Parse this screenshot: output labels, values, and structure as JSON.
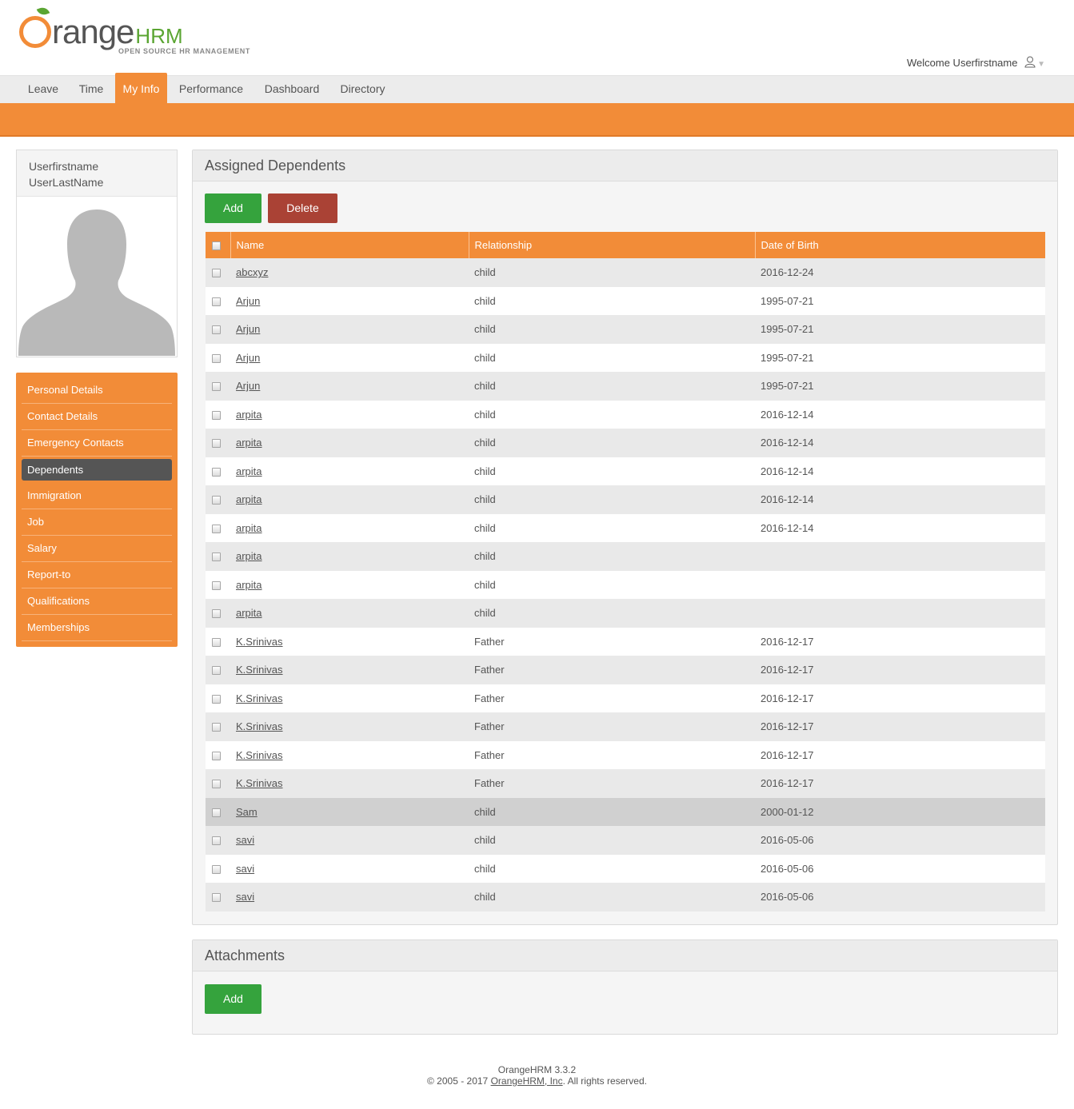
{
  "brand": {
    "name_main": "range",
    "name_hrm": "HRM",
    "tagline": "OPEN SOURCE HR MANAGEMENT",
    "accent_color": "#f28c38",
    "green_color": "#5aa532"
  },
  "header": {
    "welcome": "Welcome Userfirstname"
  },
  "nav": {
    "items": [
      "Leave",
      "Time",
      "My Info",
      "Performance",
      "Dashboard",
      "Directory"
    ],
    "active": "My Info"
  },
  "profile": {
    "first_name": "Userfirstname",
    "last_name": "UserLastName"
  },
  "side_menu": {
    "items": [
      "Personal Details",
      "Contact Details",
      "Emergency Contacts",
      "Dependents",
      "Immigration",
      "Job",
      "Salary",
      "Report-to",
      "Qualifications",
      "Memberships"
    ],
    "active": "Dependents"
  },
  "dependents": {
    "title": "Assigned Dependents",
    "add_label": "Add",
    "delete_label": "Delete",
    "columns": [
      "Name",
      "Relationship",
      "Date of Birth"
    ],
    "rows": [
      {
        "name": "abcxyz",
        "relationship": "child",
        "dob": "2016-12-24"
      },
      {
        "name": "Arjun",
        "relationship": "child",
        "dob": "1995-07-21"
      },
      {
        "name": "Arjun",
        "relationship": "child",
        "dob": "1995-07-21"
      },
      {
        "name": "Arjun",
        "relationship": "child",
        "dob": "1995-07-21"
      },
      {
        "name": "Arjun",
        "relationship": "child",
        "dob": "1995-07-21"
      },
      {
        "name": "arpita",
        "relationship": "child",
        "dob": "2016-12-14"
      },
      {
        "name": "arpita",
        "relationship": "child",
        "dob": "2016-12-14"
      },
      {
        "name": "arpita",
        "relationship": "child",
        "dob": "2016-12-14"
      },
      {
        "name": "arpita",
        "relationship": "child",
        "dob": "2016-12-14"
      },
      {
        "name": "arpita",
        "relationship": "child",
        "dob": "2016-12-14"
      },
      {
        "name": "arpita",
        "relationship": "child",
        "dob": ""
      },
      {
        "name": "arpita",
        "relationship": "child",
        "dob": ""
      },
      {
        "name": "arpita",
        "relationship": "child",
        "dob": ""
      },
      {
        "name": "K.Srinivas",
        "relationship": "Father",
        "dob": "2016-12-17"
      },
      {
        "name": "K.Srinivas",
        "relationship": "Father",
        "dob": "2016-12-17"
      },
      {
        "name": "K.Srinivas",
        "relationship": "Father",
        "dob": "2016-12-17"
      },
      {
        "name": "K.Srinivas",
        "relationship": "Father",
        "dob": "2016-12-17"
      },
      {
        "name": "K.Srinivas",
        "relationship": "Father",
        "dob": "2016-12-17"
      },
      {
        "name": "K.Srinivas",
        "relationship": "Father",
        "dob": "2016-12-17"
      },
      {
        "name": "Sam",
        "relationship": "child",
        "dob": "2000-01-12",
        "highlighted": true
      },
      {
        "name": "savi",
        "relationship": "child",
        "dob": "2016-05-06"
      },
      {
        "name": "savi",
        "relationship": "child",
        "dob": "2016-05-06"
      },
      {
        "name": "savi",
        "relationship": "child",
        "dob": "2016-05-06"
      }
    ]
  },
  "attachments": {
    "title": "Attachments",
    "add_label": "Add"
  },
  "footer": {
    "version": "OrangeHRM 3.3.2",
    "copyright_prefix": "© 2005 - 2017 ",
    "company_link": "OrangeHRM, Inc",
    "copyright_suffix": ". All rights reserved."
  }
}
